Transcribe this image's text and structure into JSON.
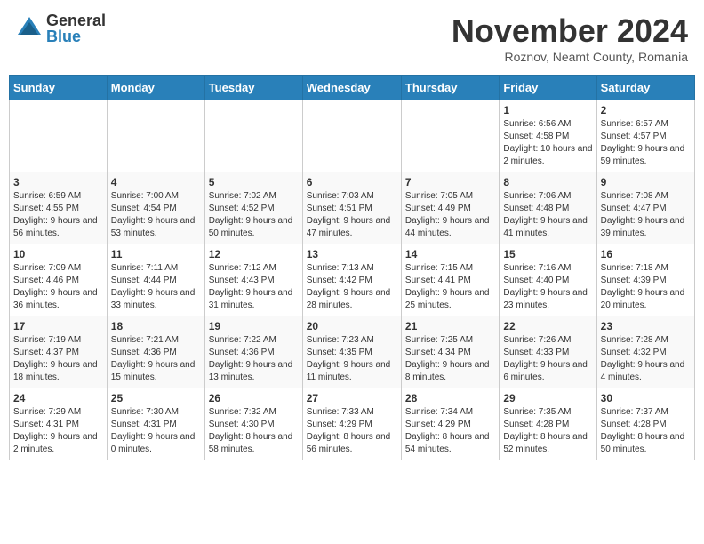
{
  "logo": {
    "general": "General",
    "blue": "Blue"
  },
  "title": "November 2024",
  "subtitle": "Roznov, Neamt County, Romania",
  "days_header": [
    "Sunday",
    "Monday",
    "Tuesday",
    "Wednesday",
    "Thursday",
    "Friday",
    "Saturday"
  ],
  "weeks": [
    [
      {
        "day": "",
        "info": ""
      },
      {
        "day": "",
        "info": ""
      },
      {
        "day": "",
        "info": ""
      },
      {
        "day": "",
        "info": ""
      },
      {
        "day": "",
        "info": ""
      },
      {
        "day": "1",
        "info": "Sunrise: 6:56 AM\nSunset: 4:58 PM\nDaylight: 10 hours and 2 minutes."
      },
      {
        "day": "2",
        "info": "Sunrise: 6:57 AM\nSunset: 4:57 PM\nDaylight: 9 hours and 59 minutes."
      }
    ],
    [
      {
        "day": "3",
        "info": "Sunrise: 6:59 AM\nSunset: 4:55 PM\nDaylight: 9 hours and 56 minutes."
      },
      {
        "day": "4",
        "info": "Sunrise: 7:00 AM\nSunset: 4:54 PM\nDaylight: 9 hours and 53 minutes."
      },
      {
        "day": "5",
        "info": "Sunrise: 7:02 AM\nSunset: 4:52 PM\nDaylight: 9 hours and 50 minutes."
      },
      {
        "day": "6",
        "info": "Sunrise: 7:03 AM\nSunset: 4:51 PM\nDaylight: 9 hours and 47 minutes."
      },
      {
        "day": "7",
        "info": "Sunrise: 7:05 AM\nSunset: 4:49 PM\nDaylight: 9 hours and 44 minutes."
      },
      {
        "day": "8",
        "info": "Sunrise: 7:06 AM\nSunset: 4:48 PM\nDaylight: 9 hours and 41 minutes."
      },
      {
        "day": "9",
        "info": "Sunrise: 7:08 AM\nSunset: 4:47 PM\nDaylight: 9 hours and 39 minutes."
      }
    ],
    [
      {
        "day": "10",
        "info": "Sunrise: 7:09 AM\nSunset: 4:46 PM\nDaylight: 9 hours and 36 minutes."
      },
      {
        "day": "11",
        "info": "Sunrise: 7:11 AM\nSunset: 4:44 PM\nDaylight: 9 hours and 33 minutes."
      },
      {
        "day": "12",
        "info": "Sunrise: 7:12 AM\nSunset: 4:43 PM\nDaylight: 9 hours and 31 minutes."
      },
      {
        "day": "13",
        "info": "Sunrise: 7:13 AM\nSunset: 4:42 PM\nDaylight: 9 hours and 28 minutes."
      },
      {
        "day": "14",
        "info": "Sunrise: 7:15 AM\nSunset: 4:41 PM\nDaylight: 9 hours and 25 minutes."
      },
      {
        "day": "15",
        "info": "Sunrise: 7:16 AM\nSunset: 4:40 PM\nDaylight: 9 hours and 23 minutes."
      },
      {
        "day": "16",
        "info": "Sunrise: 7:18 AM\nSunset: 4:39 PM\nDaylight: 9 hours and 20 minutes."
      }
    ],
    [
      {
        "day": "17",
        "info": "Sunrise: 7:19 AM\nSunset: 4:37 PM\nDaylight: 9 hours and 18 minutes."
      },
      {
        "day": "18",
        "info": "Sunrise: 7:21 AM\nSunset: 4:36 PM\nDaylight: 9 hours and 15 minutes."
      },
      {
        "day": "19",
        "info": "Sunrise: 7:22 AM\nSunset: 4:36 PM\nDaylight: 9 hours and 13 minutes."
      },
      {
        "day": "20",
        "info": "Sunrise: 7:23 AM\nSunset: 4:35 PM\nDaylight: 9 hours and 11 minutes."
      },
      {
        "day": "21",
        "info": "Sunrise: 7:25 AM\nSunset: 4:34 PM\nDaylight: 9 hours and 8 minutes."
      },
      {
        "day": "22",
        "info": "Sunrise: 7:26 AM\nSunset: 4:33 PM\nDaylight: 9 hours and 6 minutes."
      },
      {
        "day": "23",
        "info": "Sunrise: 7:28 AM\nSunset: 4:32 PM\nDaylight: 9 hours and 4 minutes."
      }
    ],
    [
      {
        "day": "24",
        "info": "Sunrise: 7:29 AM\nSunset: 4:31 PM\nDaylight: 9 hours and 2 minutes."
      },
      {
        "day": "25",
        "info": "Sunrise: 7:30 AM\nSunset: 4:31 PM\nDaylight: 9 hours and 0 minutes."
      },
      {
        "day": "26",
        "info": "Sunrise: 7:32 AM\nSunset: 4:30 PM\nDaylight: 8 hours and 58 minutes."
      },
      {
        "day": "27",
        "info": "Sunrise: 7:33 AM\nSunset: 4:29 PM\nDaylight: 8 hours and 56 minutes."
      },
      {
        "day": "28",
        "info": "Sunrise: 7:34 AM\nSunset: 4:29 PM\nDaylight: 8 hours and 54 minutes."
      },
      {
        "day": "29",
        "info": "Sunrise: 7:35 AM\nSunset: 4:28 PM\nDaylight: 8 hours and 52 minutes."
      },
      {
        "day": "30",
        "info": "Sunrise: 7:37 AM\nSunset: 4:28 PM\nDaylight: 8 hours and 50 minutes."
      }
    ]
  ]
}
